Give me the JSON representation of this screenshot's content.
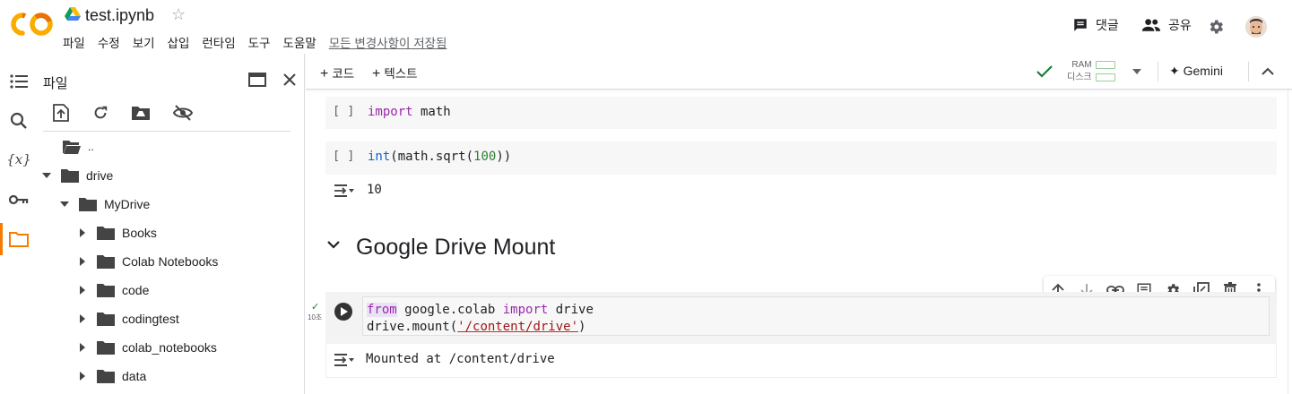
{
  "header": {
    "title": "test.ipynb",
    "menu": [
      "파일",
      "수정",
      "보기",
      "삽입",
      "런타임",
      "도구",
      "도움말"
    ],
    "saved_status": "모든 변경사항이 저장됨",
    "comment_label": "댓글",
    "share_label": "공유"
  },
  "sidebar": {
    "panel_title": "파일",
    "tree": [
      {
        "label": "..",
        "level": 0,
        "expandable": false
      },
      {
        "label": "drive",
        "level": 0,
        "expandable": true,
        "expanded": true
      },
      {
        "label": "MyDrive",
        "level": 1,
        "expandable": true,
        "expanded": true
      },
      {
        "label": "Books",
        "level": 2,
        "expandable": true,
        "expanded": false
      },
      {
        "label": "Colab Notebooks",
        "level": 2,
        "expandable": true,
        "expanded": false
      },
      {
        "label": "code",
        "level": 2,
        "expandable": true,
        "expanded": false
      },
      {
        "label": "codingtest",
        "level": 2,
        "expandable": true,
        "expanded": false
      },
      {
        "label": "colab_notebooks",
        "level": 2,
        "expandable": true,
        "expanded": false
      },
      {
        "label": "data",
        "level": 2,
        "expandable": true,
        "expanded": false
      }
    ]
  },
  "toolbar": {
    "add_code": "코드",
    "add_text": "텍스트",
    "ram_label": "RAM",
    "disk_label": "디스크",
    "gemini_label": "Gemini"
  },
  "cells": {
    "cell1": {
      "bracket": "[ ]",
      "kw": "import",
      "rest": " math"
    },
    "cell2": {
      "bracket": "[ ]",
      "fn": "int",
      "pre": "(math.sqrt(",
      "num": "100",
      "post": "))",
      "output": "10"
    },
    "section_title": "Google Drive Mount",
    "cell3": {
      "line1_kw1": "from",
      "line1_mid": " google.colab ",
      "line1_kw2": "import",
      "line1_end": " drive",
      "line2_pre": "drive.mount(",
      "line2_str": "'/content/drive'",
      "line2_post": ")",
      "exec_time": "10초",
      "output": "Mounted at /content/drive"
    }
  },
  "colors": {
    "accent_orange": "#f57c00",
    "keyword": "#9c27b0",
    "builtin": "#1565c0",
    "number": "#2e7d32",
    "string": "#a31515"
  }
}
